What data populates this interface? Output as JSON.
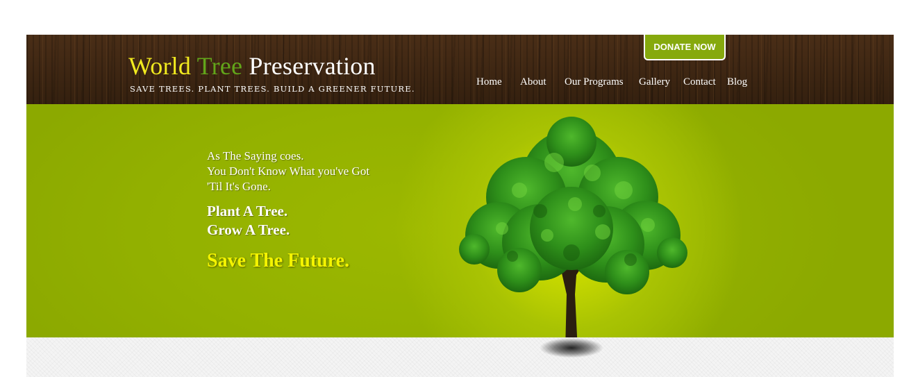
{
  "header": {
    "logo": {
      "word1": "World",
      "word2": "Tree",
      "word3": "Preservation"
    },
    "tagline": "SAVE TREES. PLANT TREES. BUILD A GREENER FUTURE.",
    "donate_label": "DONATE NOW",
    "nav": [
      {
        "label": "Home"
      },
      {
        "label": "About"
      },
      {
        "label": "Our Programs"
      },
      {
        "label": "Gallery"
      },
      {
        "label": "Contact"
      },
      {
        "label": "Blog"
      }
    ]
  },
  "hero": {
    "quote_lines": [
      "As The Saying coes.",
      "You Don't Know What you've Got",
      "'Til It's Gone."
    ],
    "plant_lines": [
      "Plant A Tree.",
      "Grow A Tree."
    ],
    "save": "Save The Future."
  },
  "colors": {
    "header_wood": "#3b2412",
    "logo_yellow": "#f1ea1f",
    "logo_green": "#62a51a",
    "hero_green": "#93b100",
    "hero_glow": "#dfe900",
    "donate_bg": "#86a90d",
    "save_yellow": "#f4f400"
  },
  "icons": [
    "tree-illustration"
  ]
}
